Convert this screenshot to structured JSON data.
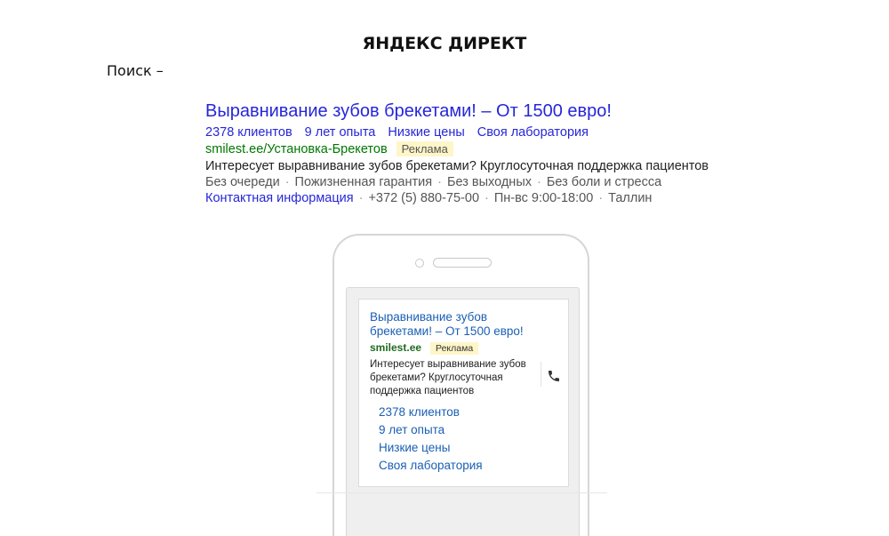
{
  "document": {
    "title": "ЯНДЕКС ДИРЕКТ",
    "search_label": "Поиск –"
  },
  "desktop_ad": {
    "title": "Выравнивание зубов брекетами! – От 1500 евро!",
    "sitelinks": [
      "2378 клиентов",
      "9 лет опыта",
      "Низкие цены",
      "Своя лаборатория"
    ],
    "url": "smilest.ee/Установка-Брекетов",
    "badge": "Реклама",
    "text": "Интересует выравнивание зубов брекетами? Круглосуточная поддержка пациентов",
    "features": [
      "Без очереди",
      "Пожизненная гарантия",
      "Без выходных",
      "Без боли и стресса"
    ],
    "contact_link": "Контактная информация",
    "phone": "+372 (5) 880-75-00",
    "hours": "Пн-вс 9:00-18:00",
    "city": "Таллин",
    "separator": "·",
    "link_color": "#2626d9",
    "url_color": "#007700"
  },
  "mobile_ad": {
    "title": "Выравнивание зубов брекетами! – От 1500 евро!",
    "url": "smilest.ee",
    "badge": "Реклама",
    "text": "Интересует выравнивание зубов брекетами? Круглосуточная поддержка пациентов",
    "call_icon": "phone-icon",
    "sitelinks": [
      "2378 клиентов",
      "9 лет опыта",
      "Низкие цены",
      "Своя лаборатория"
    ],
    "link_color": "#1a5fb4"
  }
}
